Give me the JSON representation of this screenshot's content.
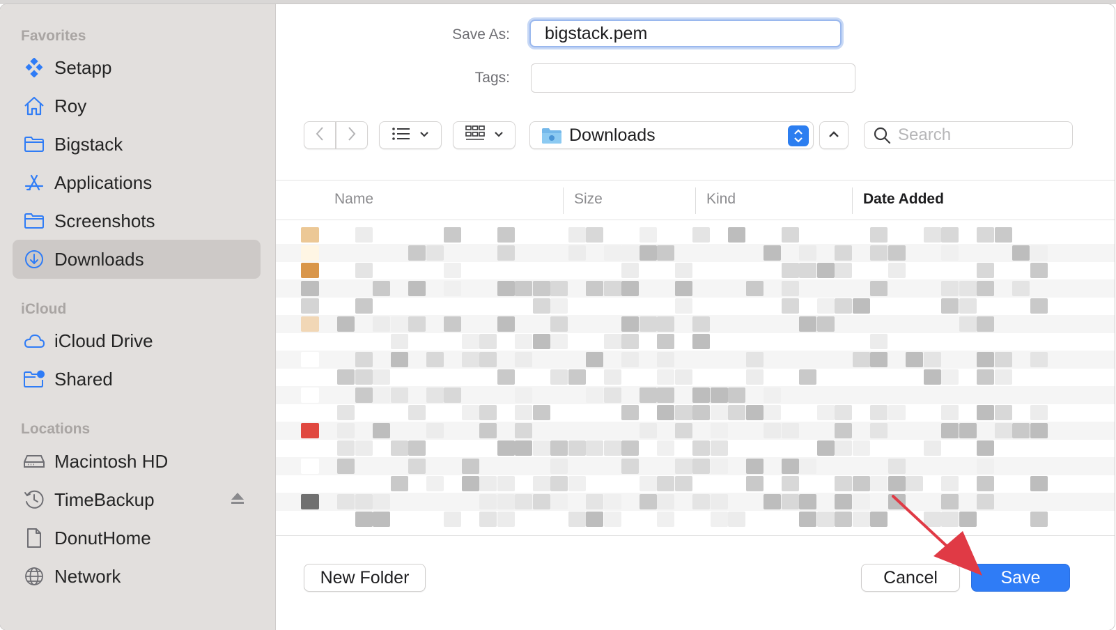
{
  "sidebar": {
    "sections": [
      {
        "title": "Favorites",
        "items": [
          {
            "label": "Setapp",
            "icon": "setapp-icon"
          },
          {
            "label": "Roy",
            "icon": "home-icon"
          },
          {
            "label": "Bigstack",
            "icon": "folder-icon"
          },
          {
            "label": "Applications",
            "icon": "applications-icon"
          },
          {
            "label": "Screenshots",
            "icon": "folder-icon"
          },
          {
            "label": "Downloads",
            "icon": "downloads-icon",
            "selected": true
          }
        ]
      },
      {
        "title": "iCloud",
        "items": [
          {
            "label": "iCloud Drive",
            "icon": "cloud-icon"
          },
          {
            "label": "Shared",
            "icon": "shared-folder-icon"
          }
        ]
      },
      {
        "title": "Locations",
        "items": [
          {
            "label": "Macintosh HD",
            "icon": "disk-icon"
          },
          {
            "label": "TimeBackup",
            "icon": "time-machine-icon",
            "eject": true
          },
          {
            "label": "DonutHome",
            "icon": "document-icon"
          },
          {
            "label": "Network",
            "icon": "network-icon"
          }
        ]
      }
    ]
  },
  "form": {
    "save_as_label": "Save As:",
    "save_as_value": "bigstack.pem",
    "tags_label": "Tags:",
    "tags_value": ""
  },
  "toolbar": {
    "location": "Downloads",
    "search_placeholder": "Search"
  },
  "columns": {
    "name": "Name",
    "size": "Size",
    "kind": "Kind",
    "date_added": "Date Added"
  },
  "buttons": {
    "new_folder": "New Folder",
    "cancel": "Cancel",
    "save": "Save"
  },
  "colors": {
    "accent": "#2f7cf6",
    "annotation_arrow": "#e03a45"
  }
}
